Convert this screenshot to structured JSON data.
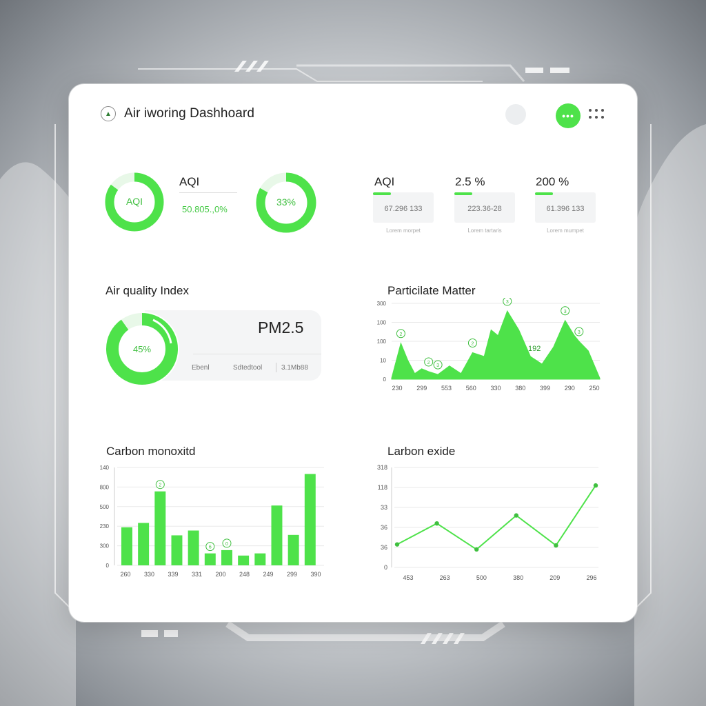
{
  "header": {
    "title": "Air iworing Dashhoard",
    "logo_icon": "leaf-icon",
    "menu_icon": "grid-dots-icon",
    "profile_icon": "avatar-circle",
    "status_label": "•••",
    "accent": "#4ee24a"
  },
  "kpis": {
    "ring1_label": "AQI",
    "ring1_value": 0.85,
    "ring2_label": "33%",
    "ring2_value": 0.83,
    "aqi_title": "AQI",
    "aqi_value": "50.805.,0%"
  },
  "stats": [
    {
      "title": "AQI",
      "value": "67.296 133",
      "sub": "Lorem morpet",
      "progress": 0.3
    },
    {
      "title": "2.5 %",
      "value": "223.36-28",
      "sub": "Lorem tartaris",
      "progress": 0.3
    },
    {
      "title": "200 %",
      "value": "61.396 133",
      "sub": "Lorem mumpet",
      "progress": 0.3
    }
  ],
  "air_quality": {
    "title": "Air quality Index",
    "ring_label": "45%",
    "ring_value": 0.9,
    "pm_label": "PM2.5",
    "footer": [
      "Ebenl",
      "Sdtedtool",
      "3.1Mb88"
    ]
  },
  "chart_data": [
    {
      "type": "area",
      "title": "Particilate Matter",
      "y_ticks": [
        "0",
        "10",
        "100",
        "100",
        "300"
      ],
      "x_ticks": [
        "230",
        "299",
        "553",
        "560",
        "330",
        "380",
        "399",
        "290",
        "250"
      ],
      "x": [
        0,
        0.4,
        0.7,
        1,
        1.3,
        1.6,
        2,
        2.5,
        3,
        3.5,
        4,
        4.3,
        4.6,
        5,
        5.5,
        6,
        6.5,
        7,
        7.5,
        7.9,
        8.1,
        8.5,
        9
      ],
      "values": [
        6,
        190,
        100,
        30,
        55,
        40,
        25,
        70,
        30,
        140,
        120,
        260,
        230,
        360,
        260,
        120,
        80,
        170,
        310,
        230,
        200,
        150,
        5
      ],
      "ylim": [
        0,
        400
      ],
      "grid": true,
      "annotations": [
        "2",
        "2",
        "3",
        "2",
        "3",
        "3",
        "3"
      ],
      "peak_label": "192"
    },
    {
      "type": "bar",
      "title": "Carbon monoxitd",
      "y_ticks": [
        "0",
        "300",
        "230",
        "500",
        "800",
        "140"
      ],
      "categories": [
        "260",
        "330",
        "339",
        "331",
        "200",
        "248",
        "249",
        "299",
        "390"
      ],
      "values": [
        175,
        195,
        340,
        138,
        160,
        55,
        70,
        45,
        55,
        275,
        140,
        420
      ],
      "ylim": [
        0,
        450
      ],
      "grid": true,
      "annotations": [
        "2",
        "6",
        "0"
      ]
    },
    {
      "type": "line",
      "title": "Larbon exide",
      "y_ticks": [
        "0",
        "36",
        "36",
        "33",
        "118",
        "318"
      ],
      "x_ticks": [
        "453",
        "263",
        "500",
        "380",
        "209",
        "296"
      ],
      "x": [
        0,
        1,
        2,
        3,
        4,
        5
      ],
      "values": [
        2.3,
        4.4,
        1.8,
        5.2,
        2.2,
        8.2
      ],
      "ylim": [
        0,
        10
      ],
      "grid": true
    }
  ]
}
